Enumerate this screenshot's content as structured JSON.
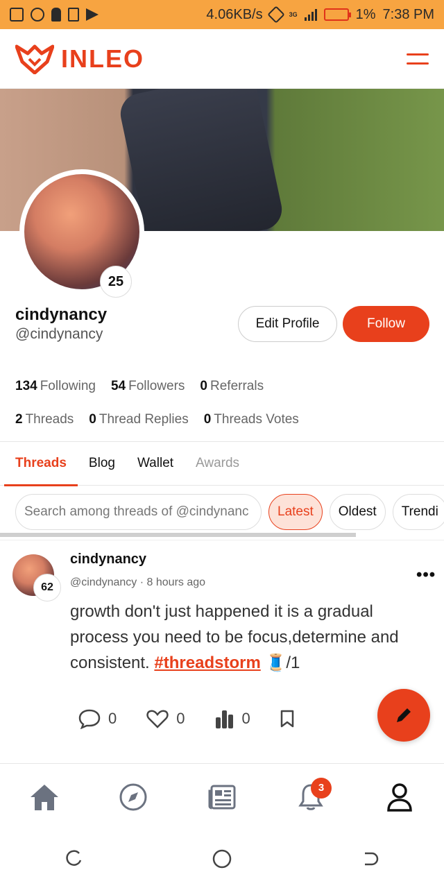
{
  "statusbar": {
    "speed": "4.06KB/s",
    "network": "3G",
    "battery": "1%",
    "time": "7:38 PM"
  },
  "header": {
    "brand": "INLEO",
    "menu_icon": "hamburger-icon"
  },
  "profile": {
    "username": "cindynancy",
    "handle": "@cindynancy",
    "level": "25",
    "edit_label": "Edit Profile",
    "follow_label": "Follow",
    "stats": {
      "following_count": "134",
      "following_label": "Following",
      "followers_count": "54",
      "followers_label": "Followers",
      "referrals_count": "0",
      "referrals_label": "Referrals",
      "threads_count": "2",
      "threads_label": "Threads",
      "replies_count": "0",
      "replies_label": "Thread Replies",
      "votes_count": "0",
      "votes_label": "Threads Votes"
    }
  },
  "tabs": [
    "Threads",
    "Blog",
    "Wallet",
    "Awards"
  ],
  "search": {
    "placeholder": "Search among threads of @cindynanc",
    "filters": [
      "Latest",
      "Oldest",
      "Trendi"
    ]
  },
  "post": {
    "user": "cindynancy",
    "handle": "@cindynancy",
    "time": "8 hours ago",
    "level": "62",
    "text_before": "growth don't just happened it is a gradual process you need to be focus,determine and consistent. ",
    "hashtag": "#threadstorm",
    "text_after": " 🧵/1",
    "replies": "0",
    "likes": "0",
    "votes": "0"
  },
  "bottomnav": {
    "notification_count": "3"
  },
  "colors": {
    "accent": "#e8401c",
    "statusbar": "#f7a441"
  }
}
